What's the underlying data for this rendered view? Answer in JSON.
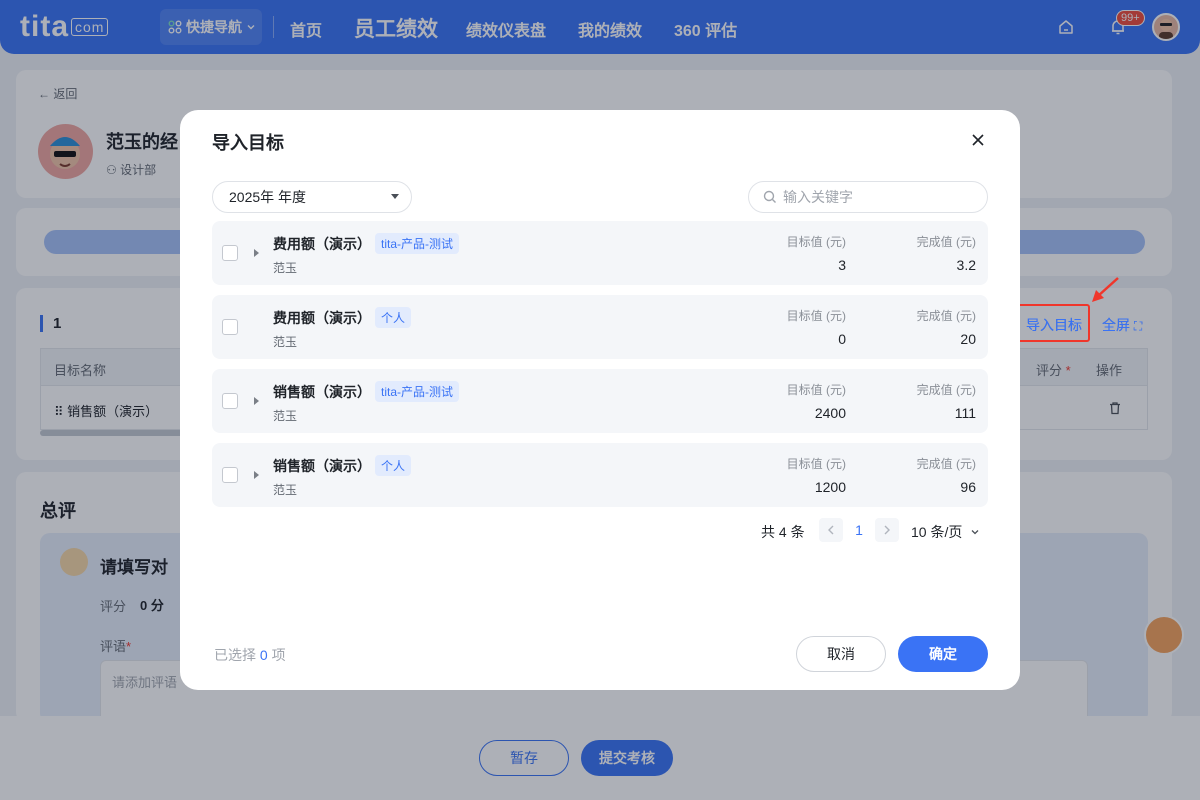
{
  "nav": {
    "logo": "tita",
    "logo_suffix": "com",
    "quick_nav": "快捷导航",
    "items": [
      "首页",
      "员工绩效",
      "绩效仪表盘",
      "我的绩效",
      "360 评估"
    ],
    "badge": "99+"
  },
  "page": {
    "back": "← 返回",
    "name": "范玉的经",
    "dept": "设计部",
    "section_count": "1",
    "table_headers": [
      "目标名称",
      "评分",
      "操作"
    ],
    "table_row_name": "⠿ 销售额（演示）",
    "import_goal": "导入目标",
    "fullscreen": "全屏",
    "summary_title": "总评",
    "reviewer_prompt": "请填写对",
    "score_label": "评分",
    "score_value": "0 分",
    "comment_label": "评语",
    "comment_placeholder": "请添加评语",
    "save_draft": "暂存",
    "submit": "提交考核"
  },
  "modal": {
    "title": "导入目标",
    "year_select": "2025年 年度",
    "search_placeholder": "输入关键字",
    "target_label": "目标值 (元)",
    "done_label": "完成值 (元)",
    "goals": [
      {
        "name": "费用额（演示）",
        "tag": "tita-产品-测试",
        "owner": "范玉",
        "target": "3",
        "done": "3.2",
        "expandable": true
      },
      {
        "name": "费用额（演示）",
        "tag": "个人",
        "owner": "范玉",
        "target": "0",
        "done": "20",
        "expandable": false
      },
      {
        "name": "销售额（演示）",
        "tag": "tita-产品-测试",
        "owner": "范玉",
        "target": "2400",
        "done": "111",
        "expandable": true
      },
      {
        "name": "销售额（演示）",
        "tag": "个人",
        "owner": "范玉",
        "target": "1200",
        "done": "96",
        "expandable": true
      }
    ],
    "pager_total": "共 4 条",
    "pager_page": "1",
    "pager_size": "10 条/页",
    "selected_prefix": "已选择",
    "selected_count": "0",
    "selected_suffix": "项",
    "cancel": "取消",
    "ok": "确定"
  },
  "colors": {
    "primary": "#3a73f5",
    "highlight": "#f0362b"
  }
}
